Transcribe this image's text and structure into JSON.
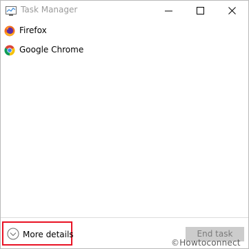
{
  "window": {
    "title": "Task Manager"
  },
  "processes": [
    {
      "name": "Firefox",
      "icon": "firefox-icon"
    },
    {
      "name": "Google Chrome",
      "icon": "chrome-icon"
    }
  ],
  "footer": {
    "more_details_label": "More details",
    "end_task_label": "End task"
  },
  "watermark": "©Howtoconnect",
  "colors": {
    "highlight_border": "#e81123",
    "disabled_button": "#cccccc"
  }
}
